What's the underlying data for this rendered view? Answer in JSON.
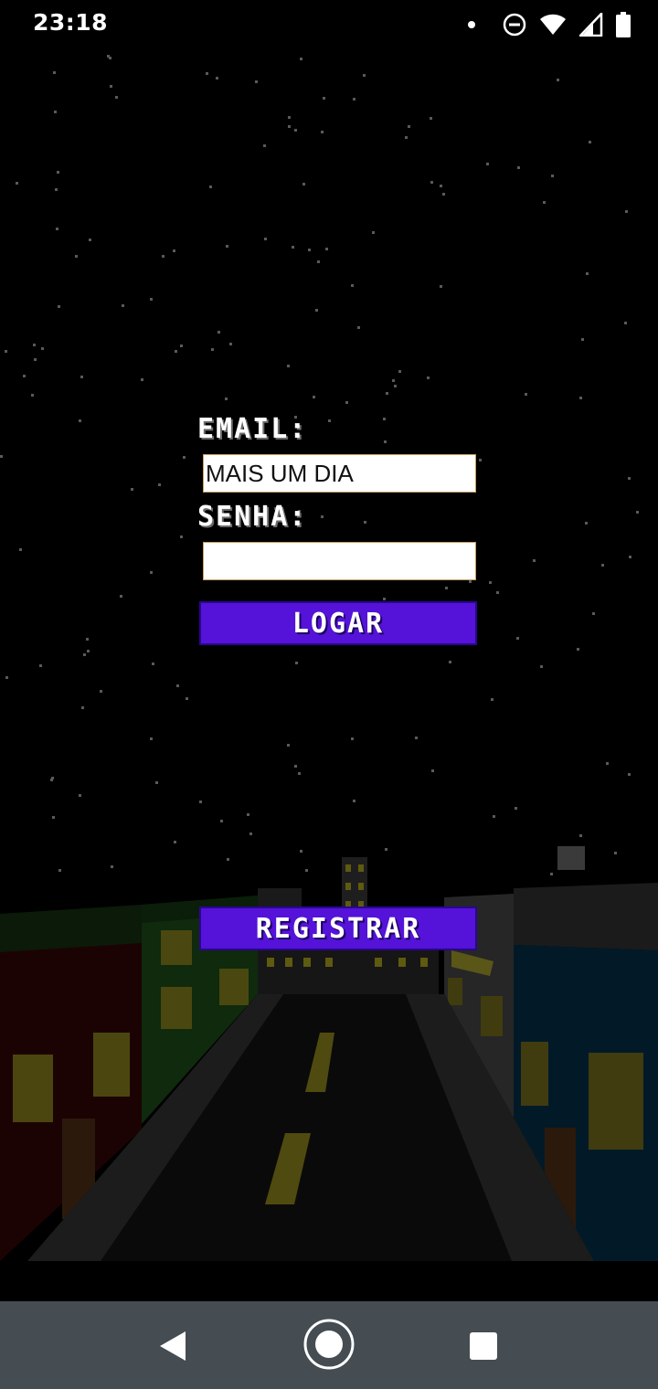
{
  "status_bar": {
    "time": "23:18",
    "icons": [
      "notification-dot-icon",
      "do-not-disturb-icon",
      "wifi-icon",
      "cell-signal-icon",
      "battery-icon"
    ]
  },
  "login_form": {
    "email_label": "EMAIL:",
    "email_value": "MAIS UM DIA",
    "password_label": "SENHA:",
    "password_value": "",
    "login_button": "LOGAR"
  },
  "register_button": "REGISTRAR",
  "nav_bar": {
    "icons": [
      "back-icon",
      "home-icon",
      "recents-icon"
    ]
  },
  "colors": {
    "button": "#5512d8",
    "background": "#000000",
    "nav_bar": "#454c52"
  }
}
